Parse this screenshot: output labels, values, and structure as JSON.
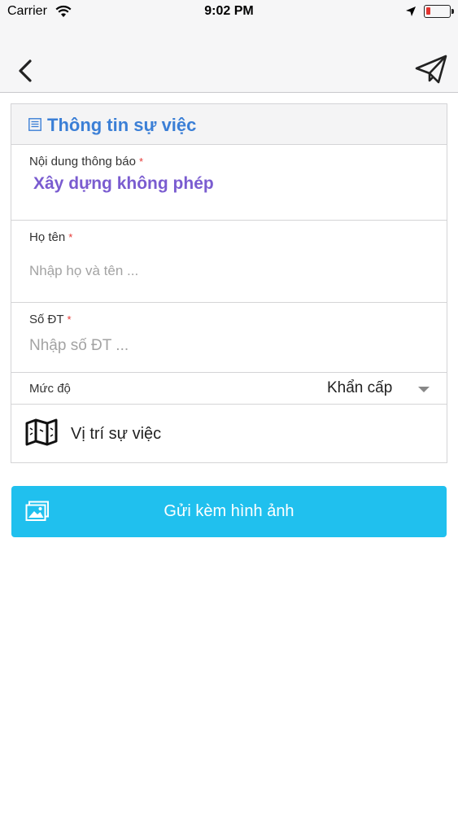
{
  "status_bar": {
    "carrier": "Carrier",
    "time": "9:02 PM"
  },
  "nav": {
    "back_icon": "chevron-left-icon",
    "send_icon": "paper-plane-icon"
  },
  "form": {
    "section_title": "Thông tin sự việc",
    "section_icon": "list-icon",
    "content": {
      "label": "Nội dung thông báo",
      "required_mark": "*",
      "value": "Xây dựng không phép"
    },
    "name": {
      "label": "Họ tên",
      "required_mark": "*",
      "placeholder": "Nhập họ và tên ..."
    },
    "phone": {
      "label": "Số ĐT",
      "required_mark": "*",
      "placeholder": "Nhập số ĐT ..."
    },
    "level": {
      "label": "Mức độ",
      "selected": "Khẩn cấp"
    },
    "location": {
      "icon": "map-icon",
      "label": "Vị trí sự việc"
    }
  },
  "attach": {
    "icon": "image-icon",
    "label": "Gửi kèm hình ảnh"
  },
  "colors": {
    "accent_blue": "#3b7fd6",
    "value_purple": "#7a5cd0",
    "button_cyan": "#20c0ee",
    "required_red": "#e53935"
  }
}
